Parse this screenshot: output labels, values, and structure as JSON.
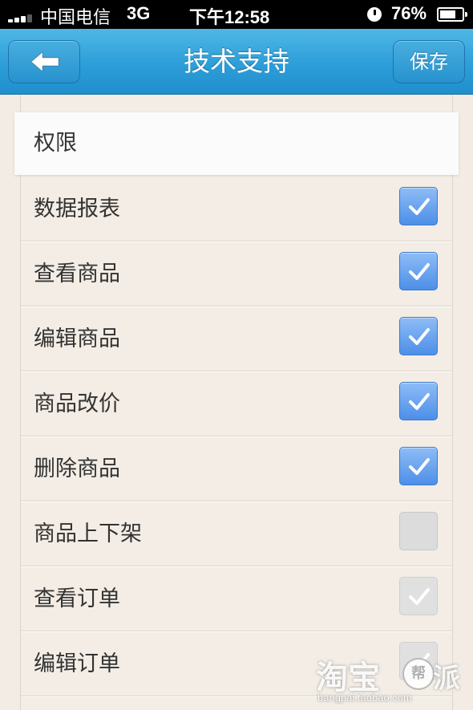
{
  "status_bar": {
    "carrier": "中国电信",
    "network": "3G",
    "time": "下午12:58",
    "battery_percent": "76%",
    "icons": [
      "signal-icon",
      "clock-icon",
      "battery-icon"
    ]
  },
  "nav": {
    "title": "技术支持",
    "back_icon": "back-arrow-icon",
    "save_label": "保存"
  },
  "section": {
    "header": "权限"
  },
  "permissions": [
    {
      "label": "数据报表",
      "checked": true,
      "enabled": true
    },
    {
      "label": "查看商品",
      "checked": true,
      "enabled": true
    },
    {
      "label": "编辑商品",
      "checked": true,
      "enabled": true
    },
    {
      "label": "商品改价",
      "checked": true,
      "enabled": true
    },
    {
      "label": "删除商品",
      "checked": true,
      "enabled": true
    },
    {
      "label": "商品上下架",
      "checked": false,
      "enabled": true
    },
    {
      "label": "查看订单",
      "checked": true,
      "enabled": false
    },
    {
      "label": "编辑订单",
      "checked": true,
      "enabled": false
    }
  ],
  "watermark": {
    "main": "淘宝",
    "bubble": "帮",
    "pai": "派",
    "url": "bangpai.taobao.com"
  },
  "colors": {
    "nav_blue": "#2d9ed9",
    "checkbox_on": "#4d8fe8",
    "checkbox_off": "#dcdcdc",
    "background": "#f2ece4"
  }
}
